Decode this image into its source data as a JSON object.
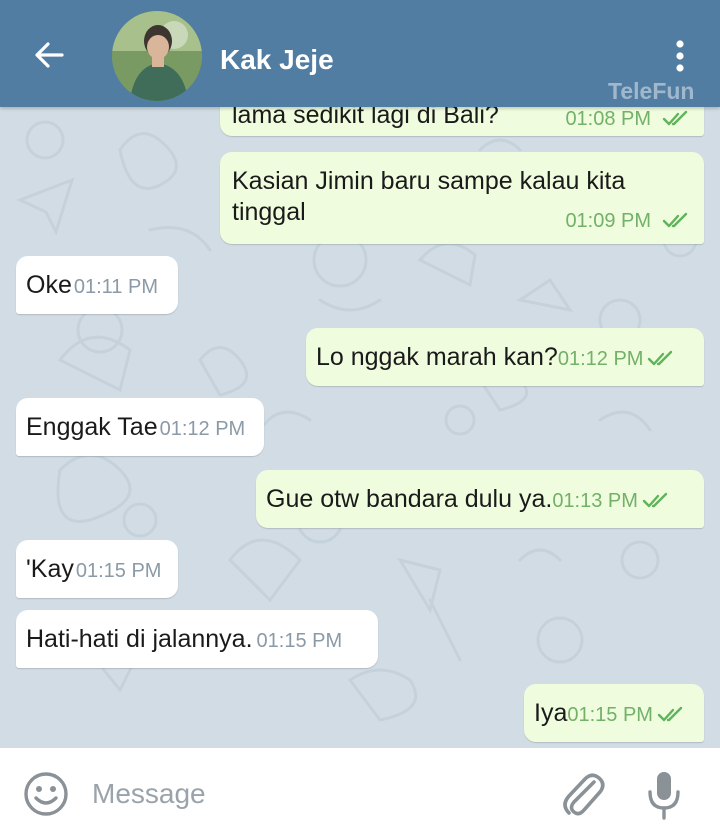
{
  "header": {
    "title": "Kak Jeje",
    "watermark": "TeleFun"
  },
  "messages": [
    {
      "side": "out",
      "text": "lama sedikit lagi di Bali?",
      "time": "01:08 PM",
      "read": true
    },
    {
      "side": "out",
      "text_line1": "Kasian Jimin baru sampe kalau kita",
      "text_line2": "tinggal",
      "time": "01:09 PM",
      "read": true
    },
    {
      "side": "in",
      "text": "Oke",
      "time": "01:11 PM"
    },
    {
      "side": "out",
      "text": "Lo nggak marah kan?",
      "time": "01:12 PM",
      "read": true
    },
    {
      "side": "in",
      "text": "Enggak Tae",
      "time": "01:12 PM"
    },
    {
      "side": "out",
      "text": "Gue otw bandara dulu ya.",
      "time": "01:13 PM",
      "read": true
    },
    {
      "side": "in",
      "text": "'Kay",
      "time": "01:15 PM"
    },
    {
      "side": "in",
      "text": "Hati-hati di jalannya.",
      "time": "01:15 PM"
    },
    {
      "side": "out",
      "text": "Iya",
      "time": "01:15 PM",
      "read": true
    }
  ],
  "input": {
    "placeholder": "Message"
  },
  "colors": {
    "header": "#527da3",
    "chat_background": "#d2dce4",
    "incoming_bubble": "#ffffff",
    "outgoing_bubble": "#effdde",
    "outgoing_time": "#73b068",
    "incoming_time": "#8b9aa6"
  },
  "icons": [
    "back-arrow-icon",
    "avatar-photo",
    "more-vertical-icon",
    "emoji-icon",
    "paperclip-icon",
    "microphone-icon",
    "double-check-icon"
  ]
}
